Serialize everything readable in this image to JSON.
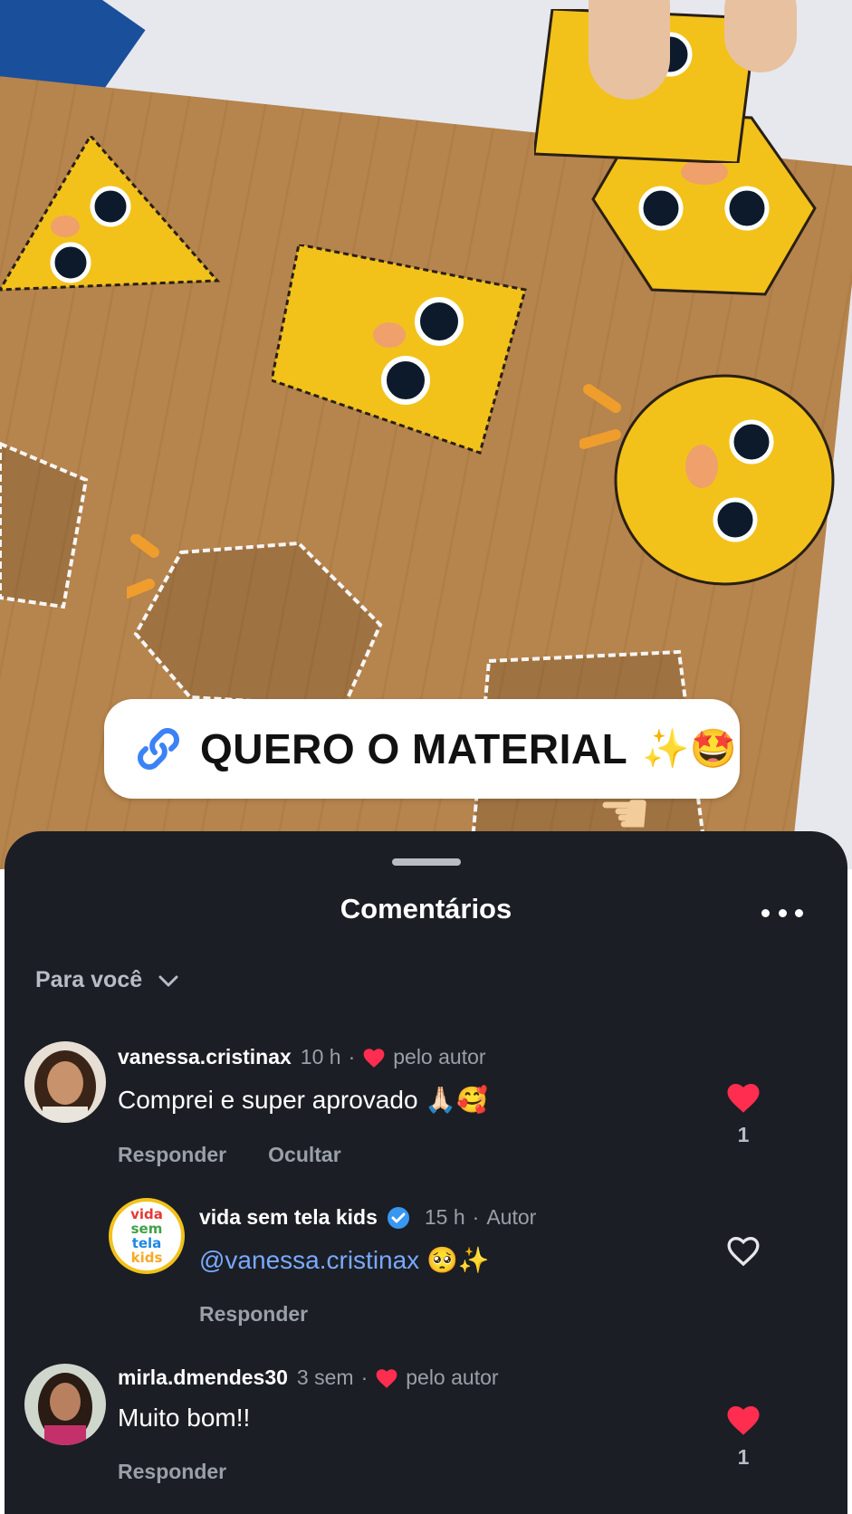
{
  "link_sticker": {
    "icon": "link-icon",
    "text": "QUERO O MATERIAL",
    "emoji": "✨🤩"
  },
  "sheet": {
    "title": "Comentários",
    "filter_label": "Para você"
  },
  "comments": [
    {
      "username": "vanessa.cristinax",
      "time": "10 h",
      "separator": "·",
      "author_tag": "pelo autor",
      "text": "Comprei e super aprovado 🙏🏻🥰",
      "actions": [
        "Responder",
        "Ocultar"
      ],
      "liked": true,
      "like_count": "1"
    },
    {
      "username": "vida sem tela kids",
      "verified": true,
      "time": "15 h",
      "separator": "·",
      "author_tag": "Autor",
      "mention": "@vanessa.cristinax",
      "text": "🥺✨",
      "actions": [
        "Responder"
      ],
      "liked": false,
      "avatar_text": [
        "vida",
        "sem",
        "tela",
        "kids"
      ]
    },
    {
      "username": "mirla.dmendes30",
      "time": "3 sem",
      "separator": "·",
      "author_tag": "pelo autor",
      "text": "Muito bom!!",
      "actions": [
        "Responder"
      ],
      "liked": true,
      "like_count": "1"
    }
  ],
  "colors": {
    "sheet_bg": "#1b1e24",
    "heart_red": "#ff2d4f",
    "mention_blue": "#79a9ff",
    "verified_blue": "#3897f0"
  }
}
